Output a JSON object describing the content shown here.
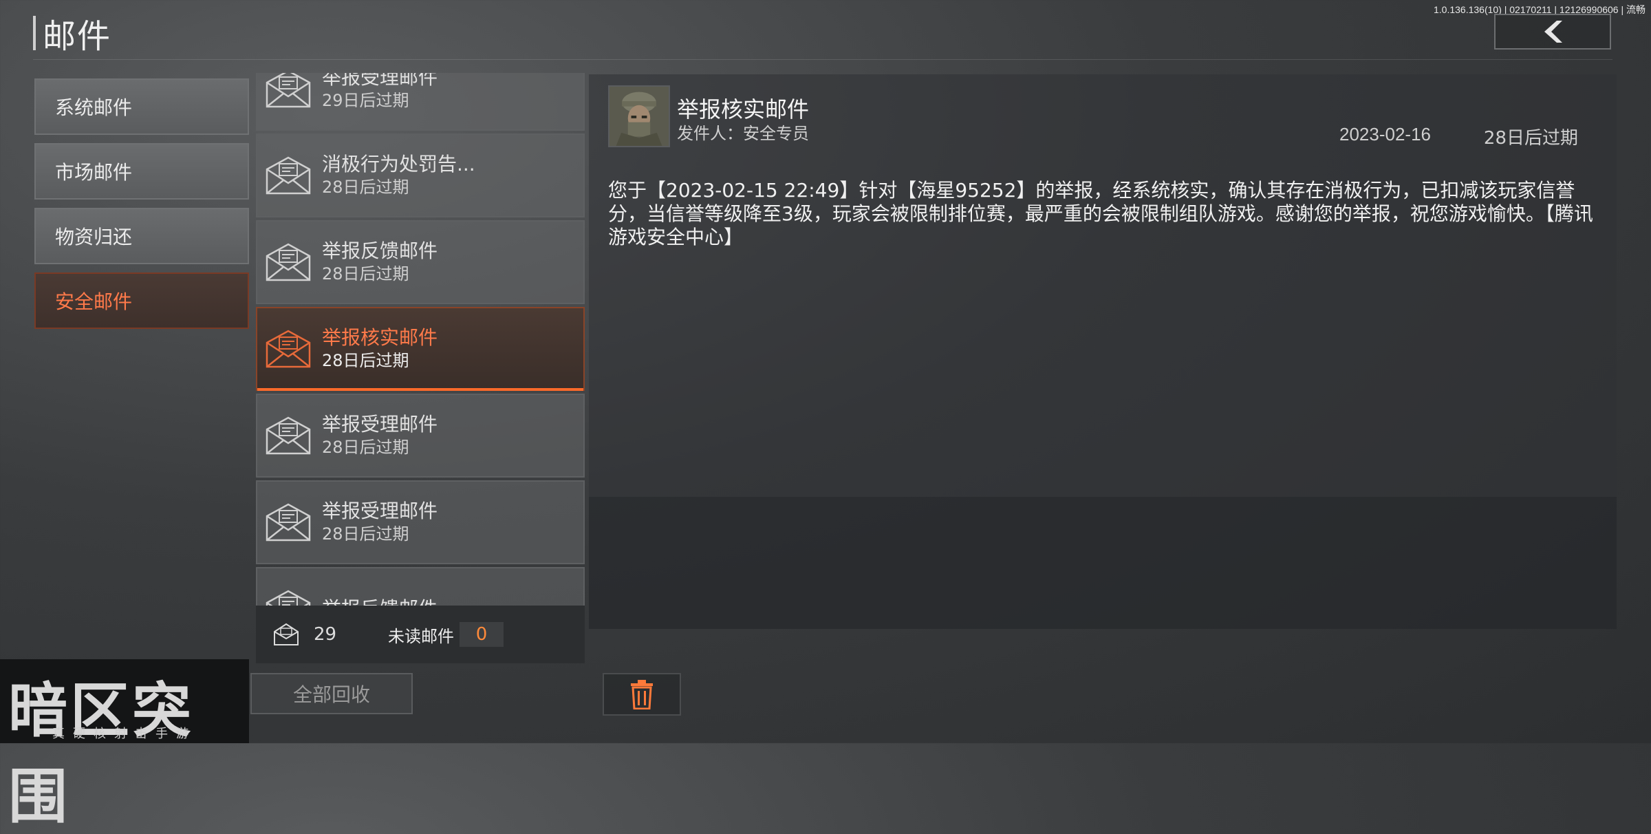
{
  "version_text": "1.0.136.136(10) | 02170211 | 12126990606 | 流畅",
  "header": {
    "title": "邮件"
  },
  "sidebar": {
    "items": [
      {
        "label": "系统邮件"
      },
      {
        "label": "市场邮件"
      },
      {
        "label": "物资归还"
      },
      {
        "label": "安全邮件",
        "active": true
      }
    ]
  },
  "mail_list": [
    {
      "title": "举报受理邮件",
      "expire": "29日后过期"
    },
    {
      "title": "消极行为处罚告...",
      "expire": "28日后过期"
    },
    {
      "title": "举报反馈邮件",
      "expire": "28日后过期"
    },
    {
      "title": "举报核实邮件",
      "expire": "28日后过期",
      "active": true
    },
    {
      "title": "举报受理邮件",
      "expire": "28日后过期"
    },
    {
      "title": "举报受理邮件",
      "expire": "28日后过期"
    },
    {
      "title": "举报反馈邮件",
      "expire": ""
    }
  ],
  "footer": {
    "total_count": "29",
    "unread_label": "未读邮件",
    "unread_count": "0",
    "reclaim_all": "全部回收"
  },
  "detail": {
    "title": "举报核实邮件",
    "sender": "发件人：安全专员",
    "date": "2023-02-16",
    "expire": "28日后过期",
    "body": "您于【2023-02-15 22:49】针对【海星95252】的举报，经系统核实，确认其存在消极行为，已扣减该玩家信誉分，当信誉等级降至3级，玩家会被限制排位赛，最严重的会被限制组队游戏。感谢您的举报，祝您游戏愉快。【腾讯游戏安全中心】"
  },
  "logo": {
    "title": "暗区突围",
    "slogan": "真硬核射击手游"
  },
  "colors": {
    "accent": "#ff7a4a",
    "accent_bar": "#ff6a2a"
  }
}
